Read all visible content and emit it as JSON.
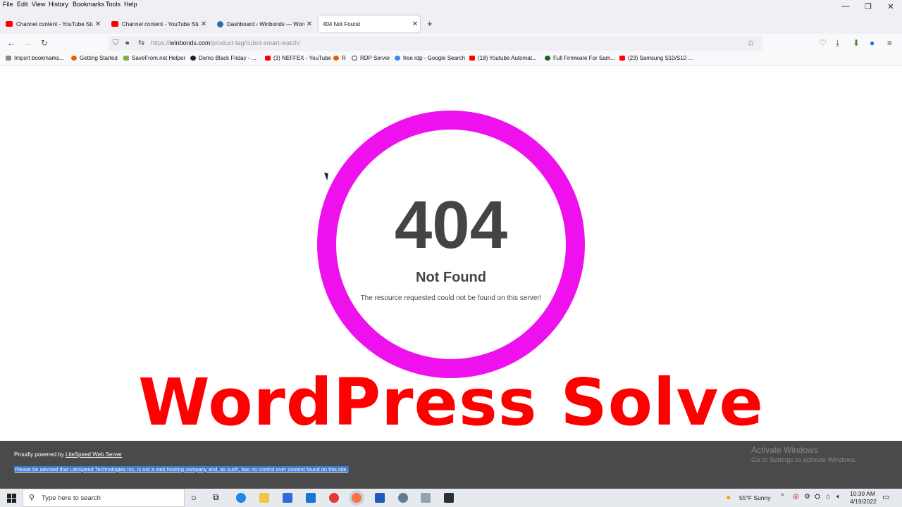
{
  "menu": [
    "File",
    "Edit",
    "View",
    "History",
    "Bookmarks",
    "Tools",
    "Help"
  ],
  "window_controls": {
    "minimize": "—",
    "restore": "❐",
    "close": "✕"
  },
  "tabs": [
    {
      "title": "Channel content - YouTube Studio",
      "icon": "youtube-icon"
    },
    {
      "title": "Channel content - YouTube Studio",
      "icon": "youtube-icon"
    },
    {
      "title": "Dashboard ‹ Winbonds — WordPress",
      "icon": "wordpress-icon"
    },
    {
      "title": "404 Not Found",
      "icon": "none"
    }
  ],
  "new_tab": "+",
  "url": {
    "prefix": "https://",
    "domain": "winbonds.com",
    "path": "/product-tag/cubot-smart-watch/"
  },
  "bookmarks": [
    "Import bookmarks...",
    "Getting Started",
    "SaveFrom.net Helper",
    "Demo Black Friday - ...",
    "(3) NEFFEX - YouTube",
    "R",
    "RDP Server",
    "free rdp - Google Search",
    "(18) Youtube Automat...",
    "Full Firmware For Sam...",
    "(23) Samsung S10/S10 ..."
  ],
  "page": {
    "code": "404",
    "title": "Not Found",
    "description": "The resource requested could not be found on this server!",
    "overlay": "WordPress Solve"
  },
  "footer": {
    "powered_prefix": "Proudly powered by ",
    "powered_link": "LiteSpeed Web Server",
    "advisory": "Please be advised that LiteSpeed Technologies Inc. is not a web hosting company and, as such, has no control over content found on this site."
  },
  "watermark": {
    "line1": "Activate Windows",
    "line2": "Go to Settings to activate Windows."
  },
  "taskbar": {
    "search_placeholder": "Type here to search",
    "weather": "55°F  Sunny",
    "time": "10:39 AM",
    "date": "4/19/2022"
  },
  "colors": {
    "ring": "#ee11ee",
    "overlay_text": "#ff0000",
    "footer_bg": "#4a4a4a"
  }
}
